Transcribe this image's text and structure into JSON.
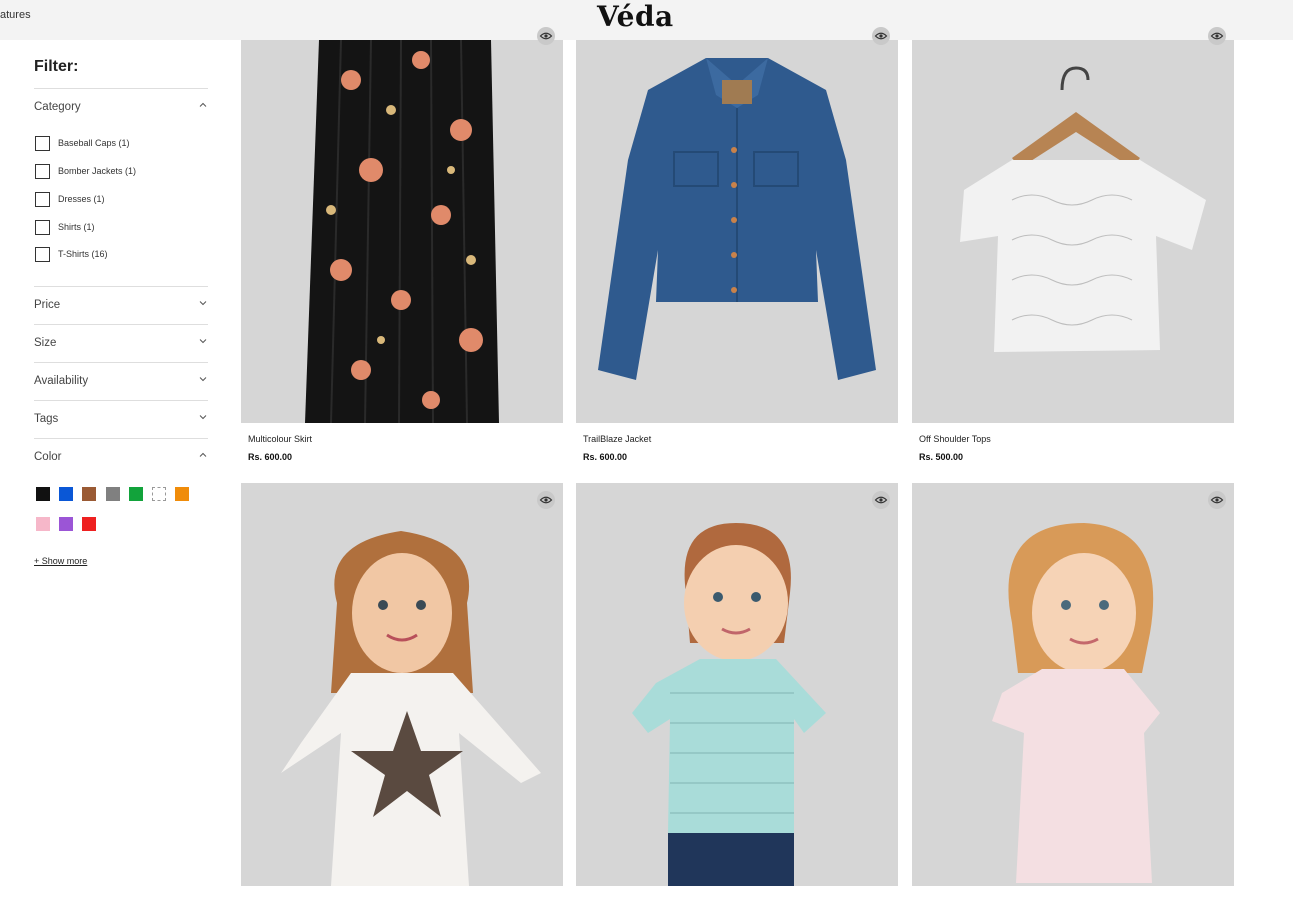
{
  "header": {
    "nav_text": "atures",
    "logo": "Véda"
  },
  "sidebar": {
    "filter_title": "Filter:",
    "category": {
      "label": "Category",
      "items": [
        {
          "label": "Baseball Caps (1)"
        },
        {
          "label": "Bomber Jackets (1)"
        },
        {
          "label": "Dresses (1)"
        },
        {
          "label": "Shirts (1)"
        },
        {
          "label": "T-Shirts (16)"
        }
      ]
    },
    "price": {
      "label": "Price"
    },
    "size": {
      "label": "Size"
    },
    "availability": {
      "label": "Availability"
    },
    "tags": {
      "label": "Tags"
    },
    "color": {
      "label": "Color",
      "swatches": [
        "#111111",
        "#0a57d6",
        "#9a5a34",
        "#808080",
        "#12a33b",
        "#ffffff",
        "#f08c0a",
        "#f6b7c9",
        "#9b55d6",
        "#ee2020"
      ],
      "show_more": "+ Show more"
    }
  },
  "products": [
    {
      "name": "Multicolour Skirt",
      "price": "Rs. 600.00",
      "icon": "eye-icon"
    },
    {
      "name": "TrailBlaze Jacket",
      "price": "Rs. 600.00",
      "icon": "eye-icon"
    },
    {
      "name": "Off Shoulder Tops",
      "price": "Rs. 500.00",
      "icon": "eye-icon"
    },
    {
      "name": "",
      "price": "",
      "icon": "eye-icon"
    },
    {
      "name": "",
      "price": "",
      "icon": "eye-icon"
    },
    {
      "name": "",
      "price": "",
      "icon": "eye-icon"
    }
  ]
}
